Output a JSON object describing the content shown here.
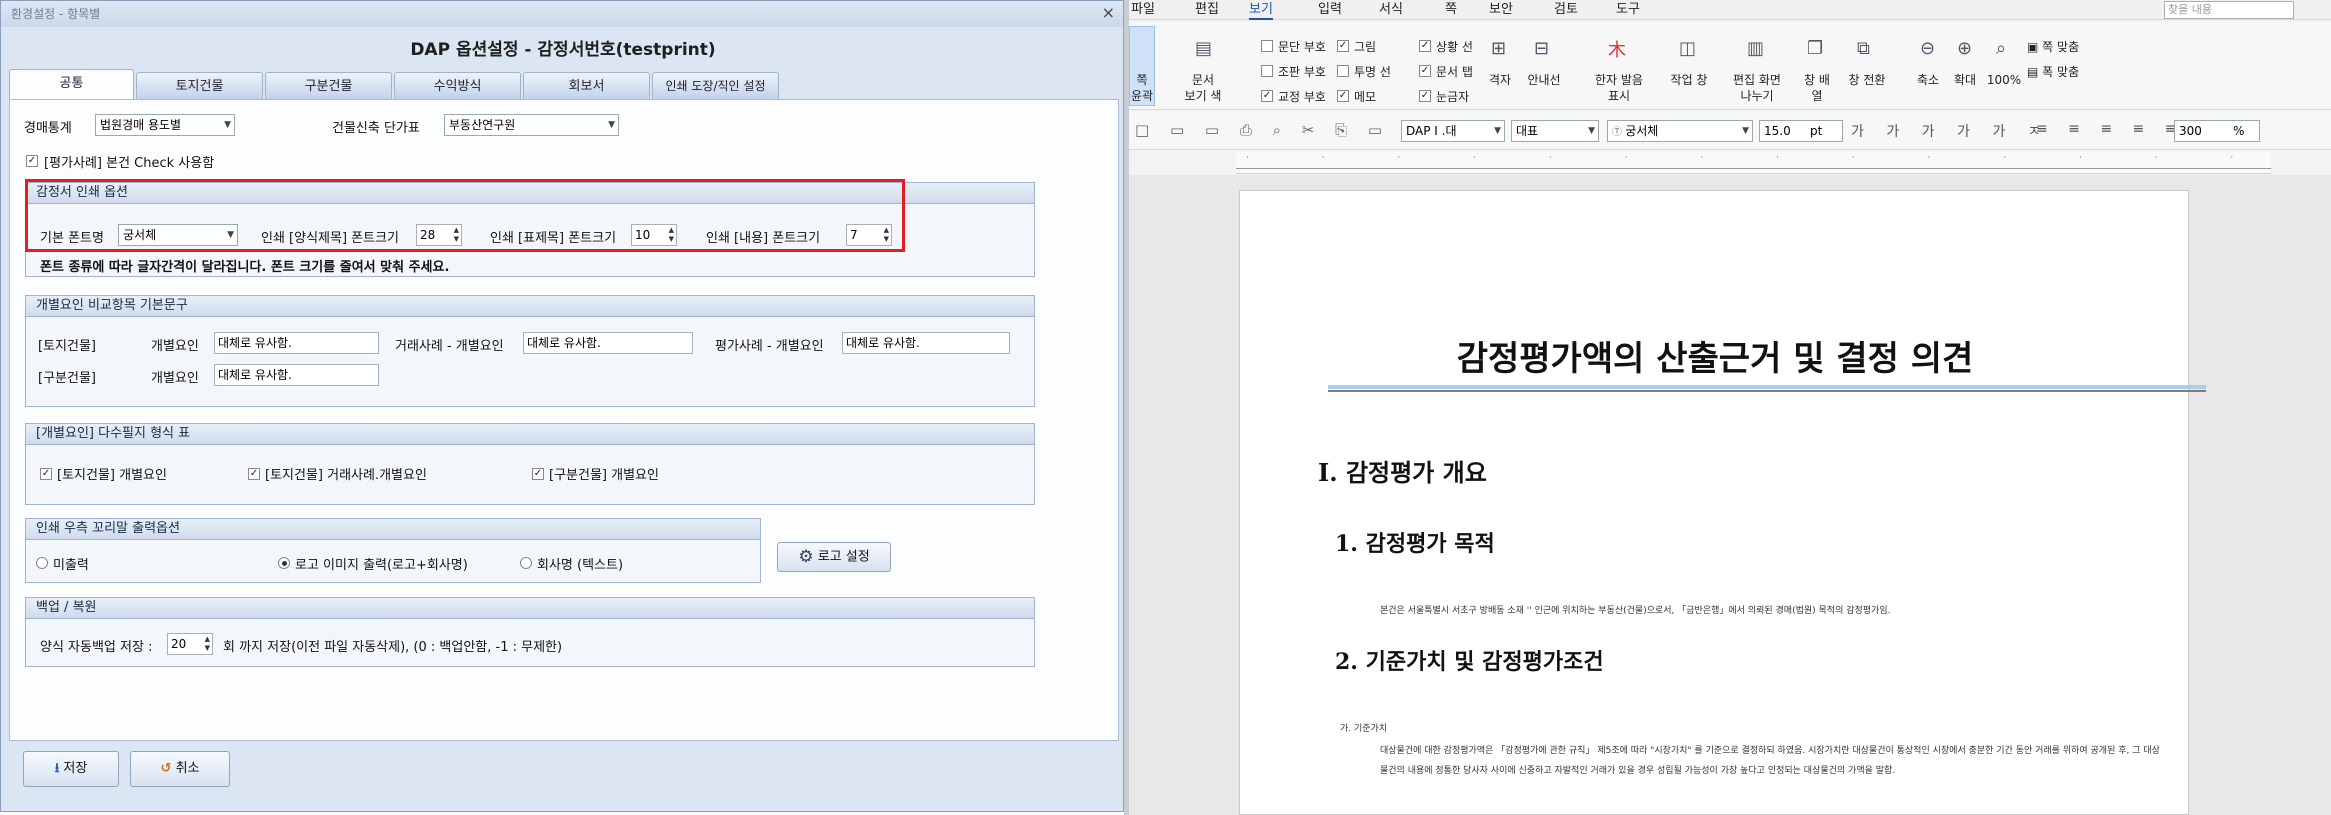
{
  "dialog": {
    "window_title": "환경설정 - 항목별",
    "close": "×",
    "header": "DAP 옵션설정 - 감정서번호(testprint)",
    "tabs": [
      "공통",
      "토지건물",
      "구분건물",
      "수익방식",
      "회보서",
      "인쇄 도장/직인 설정"
    ],
    "auction_stats_label": "경매통계",
    "auction_stats_value": "법원경매 용도별",
    "building_cost_label": "건물신축 단가표",
    "building_cost_value": "부동산연구원",
    "valuation_check_label": "[평가사례] 본건 Check 사용함",
    "print_group": {
      "title": "감정서 인쇄 옵션",
      "font_name_label": "기본 폰트명",
      "font_name_value": "궁서체",
      "form_title_font_label": "인쇄 [양식제목] 폰트크기",
      "form_title_font_value": "28",
      "table_title_font_label": "인쇄 [표제목] 폰트크기",
      "table_title_font_value": "10",
      "content_font_label": "인쇄 [내용] 폰트크기",
      "content_font_value": "7",
      "note": "폰트 종류에 따라 글자간격이 달라집니다. 폰트 크기를 줄여서 맞춰 주세요."
    },
    "factor_group": {
      "title": "개별요인 비교항목 기본문구",
      "land_building": "[토지건물]",
      "individual_factor": "개별요인",
      "individual_value": "대체로 유사함.",
      "trade_label": "거래사례 - 개별요인",
      "trade_value": "대체로 유사함.",
      "eval_label": "평가사례 - 개별요인",
      "eval_value": "대체로 유사함.",
      "divided_building": "[구분건물]",
      "divided_factor": "개별요인",
      "divided_value": "대체로 유사함."
    },
    "multi_group": {
      "title": "[개별요인] 다수필지 형식 표",
      "items": [
        "[토지건물] 개별요인",
        "[토지건물] 거래사례.개별요인",
        "[구분건물] 개별요인"
      ]
    },
    "footer_group": {
      "title": "인쇄 우측 꼬리말 출력옵션",
      "options": [
        "미출력",
        "로고 이미지 출력(로고+회사명)",
        "회사명 (텍스트)"
      ],
      "logo_button": "로고 설정"
    },
    "backup_group": {
      "title": "백업 / 복원",
      "label": "양식 자동백업 저장 :",
      "value": "20",
      "suffix": "회 까지 저장(이전 파일 자동삭제), (0 : 백업안함, -1 : 무제한)"
    },
    "save_button": "저장",
    "cancel_button": "취소"
  },
  "editor": {
    "menu": [
      "파일",
      "편집",
      "보기",
      "입력",
      "서식",
      "쪽",
      "보안",
      "검토",
      "도구"
    ],
    "search_placeholder": "찾을 내용",
    "ribbon_left": [
      "쪽",
      "윤곽"
    ],
    "ribbon_doc_view": [
      "문서",
      "보기 색"
    ],
    "checkboxes_col1": [
      "문단 부호",
      "조판 부호",
      "교정 부호"
    ],
    "checkboxes_col2": [
      "그림",
      "투명 선",
      "메모"
    ],
    "checkboxes_col3": [
      "상황 선",
      "문서 탭",
      "눈금자"
    ],
    "ribbon_buttons": [
      "격자",
      "안내선",
      "한자 발음 표시",
      "작업 창",
      "편집 화면 나누기",
      "창 배열",
      "창 전환",
      "축소",
      "확대",
      "100%",
      "쪽 맞춤",
      "폭 맞춤"
    ],
    "style_value": "DAP I .대",
    "style2_value": "대표",
    "font_value": "궁서체",
    "size_value": "15.0",
    "size_unit": "pt",
    "zoom_value": "300",
    "zoom_unit": "%",
    "doc_title": "감정평가액의 산출근거 및 결정 의견",
    "h1": "I. 감정평가 개요",
    "h2a": "1. 감정평가 목적",
    "p1": "본건은 서울특별시 서초구 방배동 소재 '' 인근에 위치하는 부동산(건물)으로서, 「금반은행」에서 의뢰된 경매(법원) 목적의 감정평가임.",
    "h2b": "2. 기준가치 및 감정평가조건",
    "small_heading": "가. 기준가치",
    "p2": "대상물건에 대한 감정평가액은 「감정평가에 관한 규칙」 제5조에 따라 \"시장가치\" 를 기준으로 결정하되 하였음. 시장가치란 대상물건이 통상적인 시장에서 충분한 기간 동안 거래를 위하여 공개된 후, 그 대상물건의 내용에 정통한 당사자 사이에 신중하고 자발적인 거래가 있을 경우 성립될 가능성이 가장 높다고 인정되는 대상물건의 가액을 말함."
  }
}
